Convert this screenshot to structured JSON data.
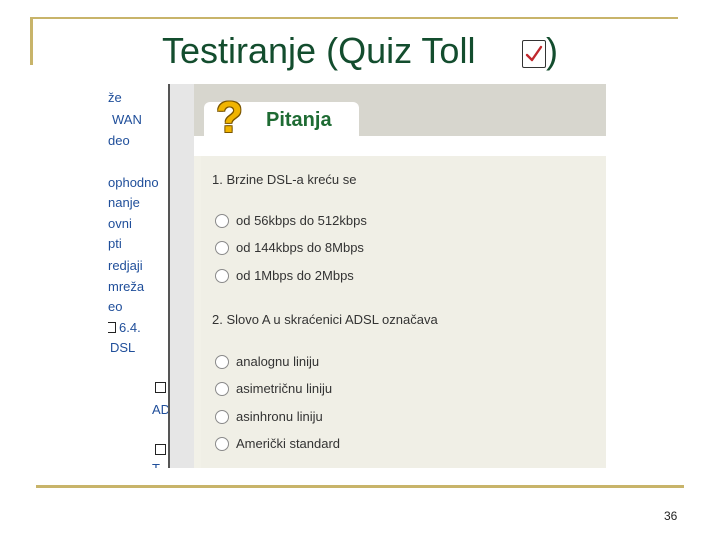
{
  "slide": {
    "title": "Testiranje (Quiz Toll ",
    "title_close": ")",
    "page_number": "36"
  },
  "sidebar": {
    "items": [
      "že",
      "WAN",
      "deo",
      "ophodno",
      "nanje",
      "ovni",
      "pti",
      "redjaji",
      "mreža",
      "eo",
      "6.4.",
      "DSL",
      "AD",
      "T"
    ]
  },
  "quiz": {
    "tab_icon": "question-mark-icon",
    "tab_label": "Pitanja",
    "questions": [
      {
        "text": "1. Brzine DSL-a kreću se",
        "options": [
          "od 56kbps do 512kbps",
          "od 144kbps do 8Mbps",
          "od 1Mbps do 2Mbps"
        ]
      },
      {
        "text": "2. Slovo A u skraćenici ADSL označava",
        "options": [
          "analognu liniju",
          "asimetričnu liniju",
          "asinhronu liniju",
          "Američki standard"
        ]
      }
    ]
  },
  "colors": {
    "title": "#134d2e",
    "decor": "#c8b46a",
    "tab_label": "#1e6b33",
    "question_mark": "#f0b400",
    "sidebar_text": "#1f4e9a"
  }
}
